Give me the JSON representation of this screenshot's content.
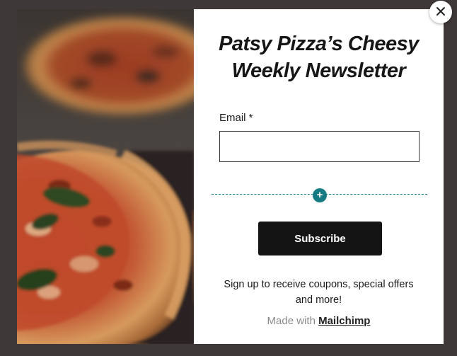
{
  "popup": {
    "title": "Patsy Pizza’s Cheesy Weekly Newsletter",
    "image_alt": "pizza-photo"
  },
  "form": {
    "email_label": "Email *",
    "email_value": "",
    "email_placeholder": "",
    "subscribe_label": "Subscribe",
    "add_block_label": "+"
  },
  "footer": {
    "signup_text": "Sign up to receive coupons, special offers and more!",
    "made_with_prefix": "Made with",
    "made_with_link": "Mailchimp"
  },
  "icons": {
    "close": "close-icon",
    "add": "plus-icon"
  },
  "colors": {
    "overlay": "#3f3838",
    "accent": "#167a82",
    "button": "#141414"
  }
}
